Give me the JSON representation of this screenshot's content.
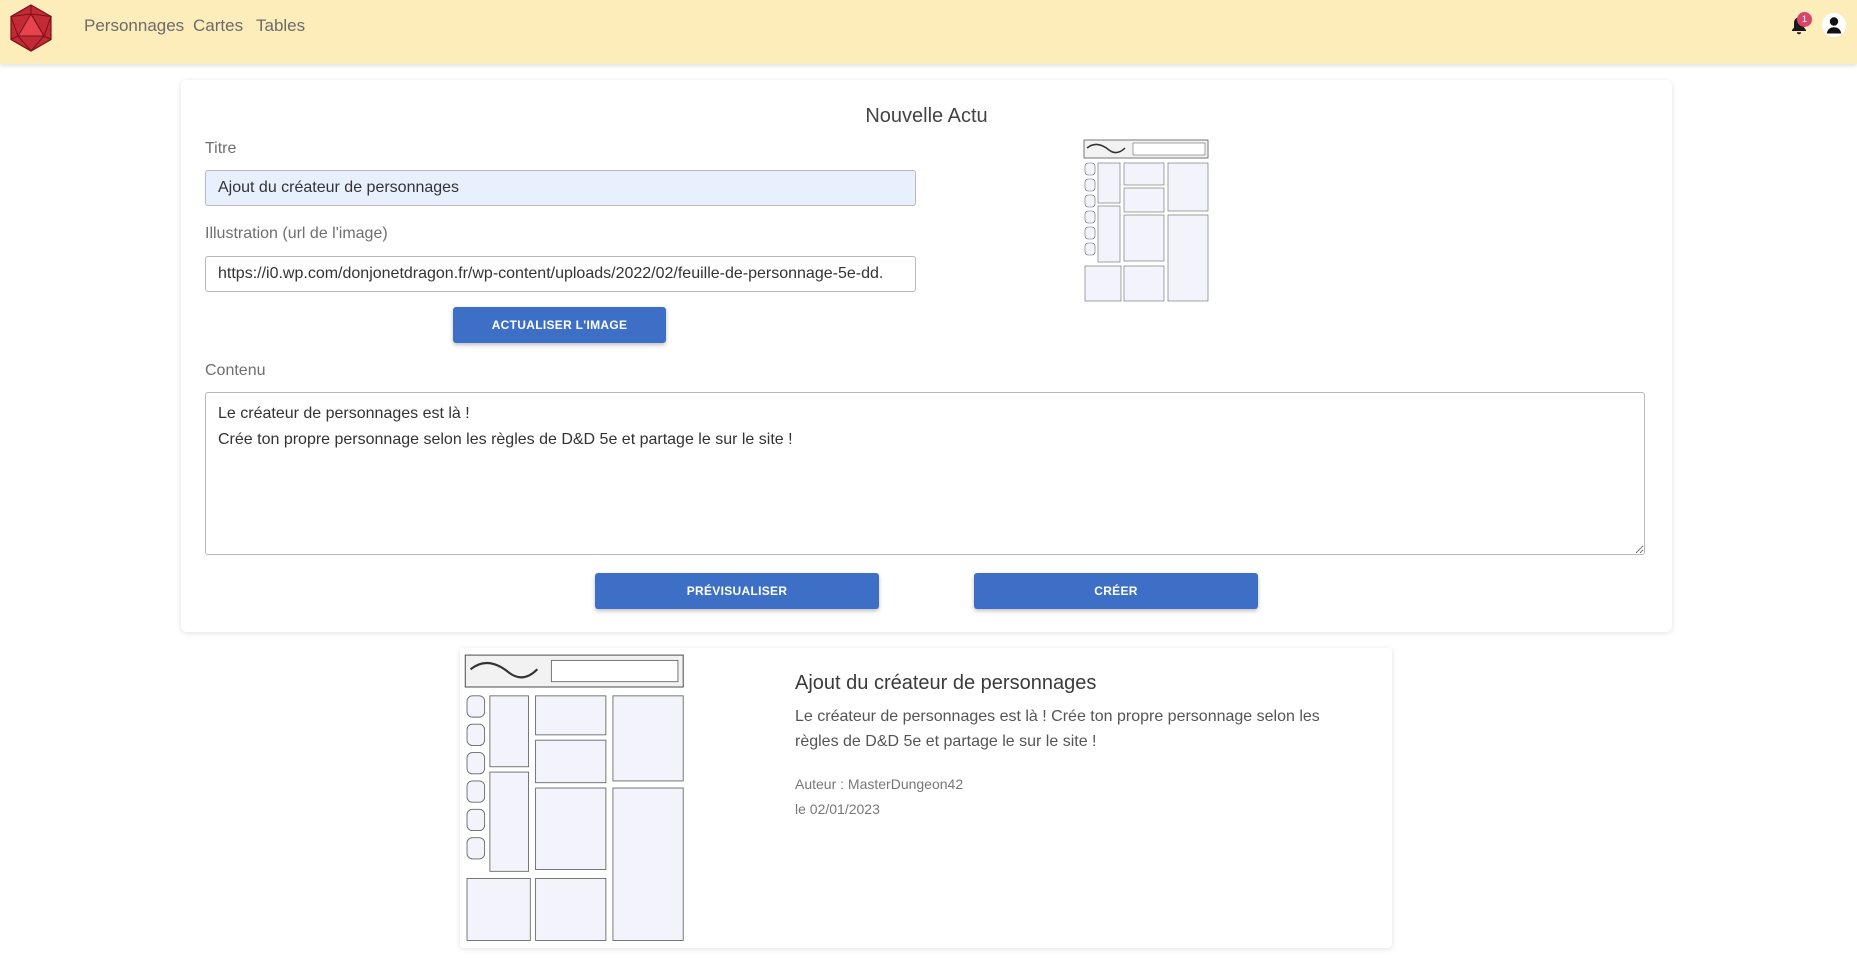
{
  "nav": {
    "links": [
      "Personnages",
      "Cartes",
      "Tables"
    ],
    "notification_count": "1"
  },
  "form": {
    "heading": "Nouvelle Actu",
    "title_label": "Titre",
    "title_value": "Ajout du créateur de personnages",
    "illustration_label": "Illustration (url de l'image)",
    "illustration_value": "https://i0.wp.com/donjonetdragon.fr/wp-content/uploads/2022/02/feuille-de-personnage-5e-dd.",
    "refresh_button": "Actualiser l'image",
    "content_label": "Contenu",
    "content_value": "Le créateur de personnages est là !\nCrée ton propre personnage selon les règles de D&D 5e et partage le sur le site !",
    "preview_button": "Prévisualiser",
    "create_button": "Créer"
  },
  "preview": {
    "title": "Ajout du créateur de personnages",
    "content": "Le créateur de personnages est là ! Crée ton propre personnage selon les règles de D&D 5e et partage le sur le site !",
    "author": "Auteur : MasterDungeon42",
    "date": "le 02/01/2023"
  },
  "colors": {
    "navbar": "#fdedba",
    "primary": "#3d6fc7",
    "logo": "#d9333f",
    "badge": "#d9456a"
  },
  "icons": [
    "d20-logo-icon",
    "bell-icon",
    "user-avatar-icon"
  ]
}
